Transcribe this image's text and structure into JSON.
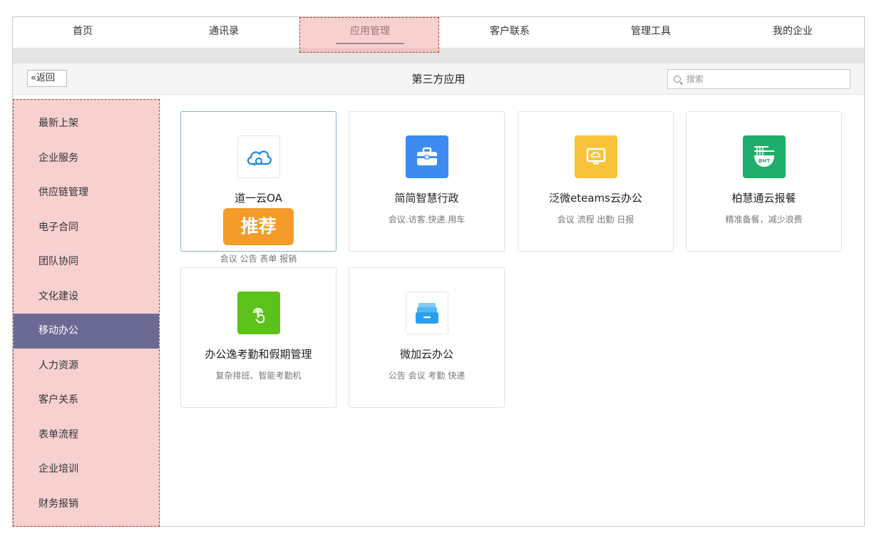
{
  "nav": {
    "tabs": [
      "首页",
      "通讯录",
      "应用管理",
      "客户联系",
      "管理工具",
      "我的企业"
    ],
    "active_index": 2
  },
  "toolbar": {
    "back_label": "«返回",
    "title": "第三方应用",
    "search_placeholder": "搜索"
  },
  "sidebar": {
    "items": [
      "最新上架",
      "企业服务",
      "供应链管理",
      "电子合同",
      "团队协同",
      "文化建设",
      "移动办公",
      "人力资源",
      "客户关系",
      "表单流程",
      "企业培训",
      "财务报销"
    ],
    "active_index": 6
  },
  "apps": [
    {
      "name": "道一云OA",
      "desc": "会议 公告 表单 报销",
      "badge": "推荐",
      "icon": "cloud-icon",
      "icon_color": "#ffffff"
    },
    {
      "name": "简简智慧行政",
      "desc": "会议.访客.快递.用车",
      "icon": "briefcase-icon",
      "icon_color": "#3d8bf0"
    },
    {
      "name": "泛微eteams云办公",
      "desc": "会议 流程 出勤 日报",
      "icon": "monitor-icon",
      "icon_color": "#f8c23a"
    },
    {
      "name": "柏慧通云报餐",
      "desc": "精准备餐，减少浪费",
      "icon": "noodle-bowl-icon",
      "icon_color": "#1fae6b"
    },
    {
      "name": "办公逸考勤和假期管理",
      "desc": "复杂排班、智能考勤机",
      "icon": "fingerprint-icon",
      "icon_color": "#5cc219"
    },
    {
      "name": "微加云办公",
      "desc": "公告 会议 考勤 快递",
      "icon": "drawer-icon",
      "icon_color": "#3aa8f0"
    }
  ],
  "colors": {
    "accent": "#6b6a94",
    "highlight": "#f0aaaa",
    "badge": "#f39c2a"
  }
}
